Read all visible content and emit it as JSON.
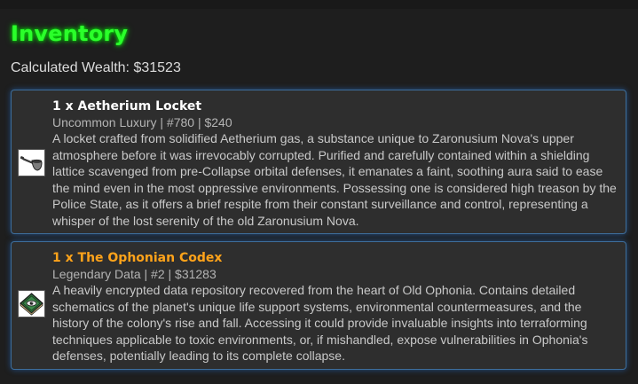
{
  "page": {
    "title": "Inventory",
    "wealth_label": "Calculated Wealth: $31523"
  },
  "items": [
    {
      "quantity": "1",
      "name": "1 x Aetherium Locket",
      "meta": "Uncommon Luxury | #780 | $240",
      "description": "A locket crafted from solidified Aetherium gas, a substance unique to Zaronusium Nova's upper atmosphere before it was irrevocably corrupted. Purified and carefully contained within a shielding lattice scavenged from pre-Collapse orbital defenses, it emanates a faint, soothing aura said to ease the mind even in the most oppressive environments. Possessing one is considered high treason by the Police State, as it offers a brief respite from their constant surveillance and control, representing a whisper of the lost serenity of the old Zaronusium Nova.",
      "icon": "locket-pipe-icon",
      "name_color": "#ffffff"
    },
    {
      "quantity": "1",
      "name": "1 x The Ophonian Codex",
      "meta": "Legendary Data | #2 | $31283",
      "description": "A heavily encrypted data repository recovered from the heart of Old Ophonia. Contains detailed schematics of the planet's unique life support systems, environmental countermeasures, and the history of the colony's rise and fall. Accessing it could provide invaluable insights into terraforming techniques applicable to toxic environments, or, if mishandled, expose vulnerabilities in Ophonia's defenses, potentially leading to its complete collapse.",
      "icon": "codex-eye-icon",
      "name_color": "#ffa31a"
    }
  ],
  "colors": {
    "title": "#2bff2b",
    "card_border": "#3d6e9c",
    "legendary": "#ffa31a"
  }
}
